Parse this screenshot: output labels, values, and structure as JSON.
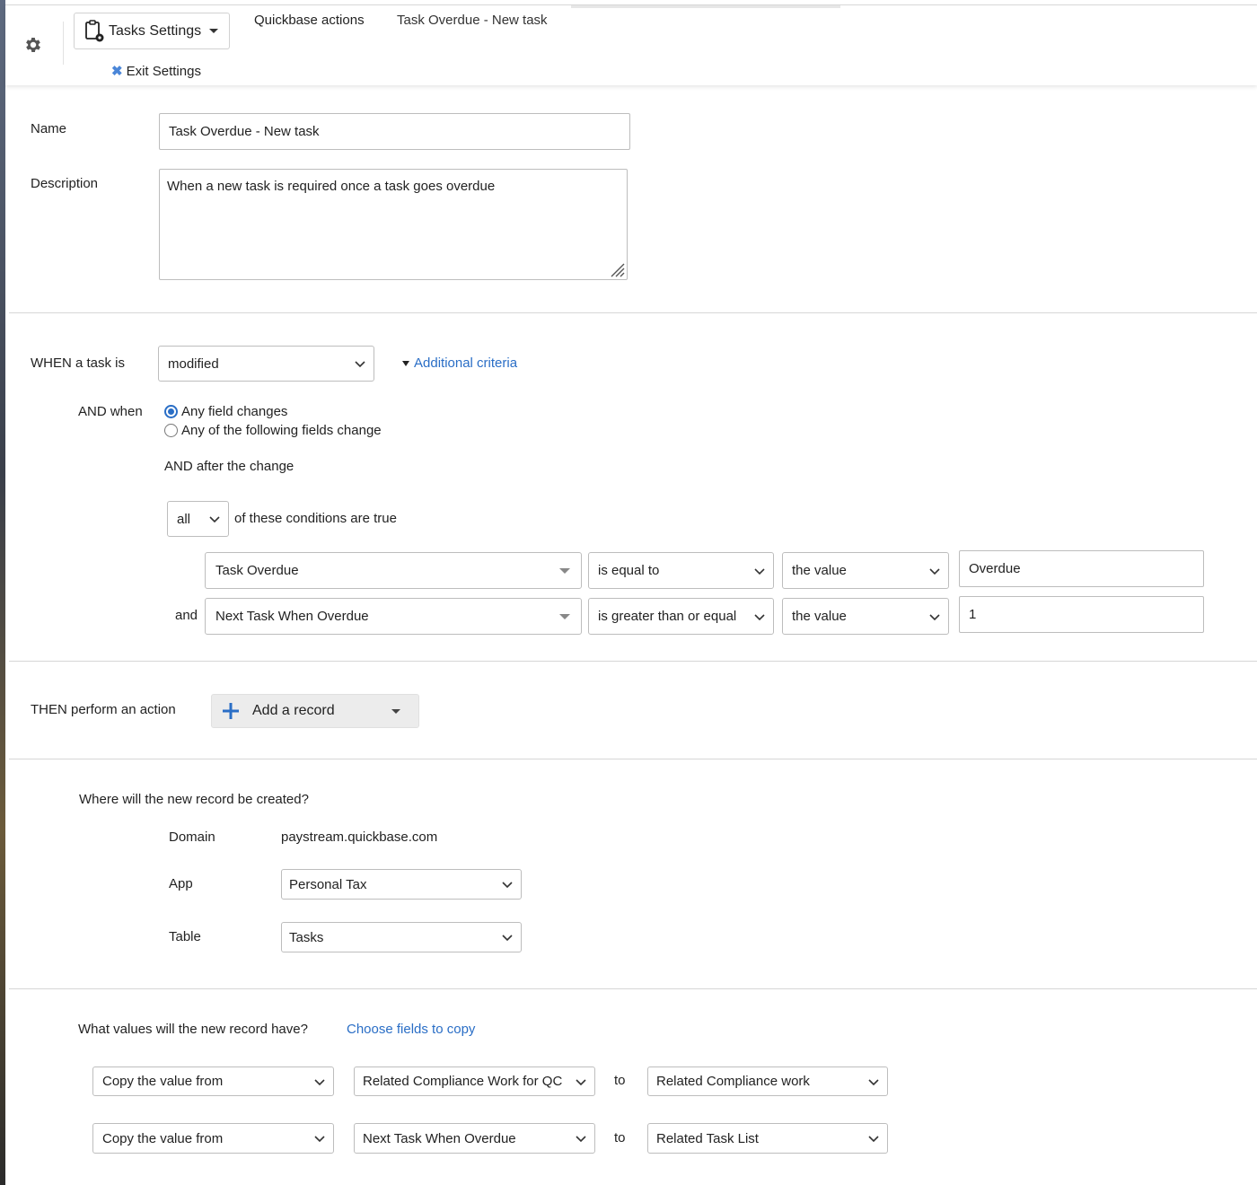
{
  "header": {
    "settings_menu_label": "Tasks Settings",
    "exit_label": "Exit Settings",
    "breadcrumb_actions": "Quickbase actions",
    "breadcrumb_current": "Task Overdue - New task"
  },
  "form": {
    "name_label": "Name",
    "name_value": "Task Overdue - New task",
    "description_label": "Description",
    "description_value": "When a new task is required once a task goes overdue"
  },
  "trigger": {
    "when_label": "WHEN a task is",
    "when_value": "modified",
    "additional_criteria": "Additional criteria",
    "and_when_label": "AND when",
    "radio_any_field": "Any field changes",
    "radio_following_fields": "Any of the following fields change",
    "after_change_label": "AND after the change",
    "quantifier_value": "all",
    "conditions_suffix": "of these conditions are true",
    "conditions": [
      {
        "connector": "",
        "field": "Task Overdue",
        "operator": "is equal to",
        "compare": "the value",
        "value": "Overdue"
      },
      {
        "connector": "and",
        "field": "Next Task When Overdue",
        "operator": "is greater than or equal",
        "compare": "the value",
        "value": "1"
      }
    ]
  },
  "action": {
    "then_label": "THEN perform an action",
    "action_button": "Add a record"
  },
  "destination": {
    "question": "Where will the new record be created?",
    "domain_label": "Domain",
    "domain_value": "paystream.quickbase.com",
    "app_label": "App",
    "app_value": "Personal Tax",
    "table_label": "Table",
    "table_value": "Tasks"
  },
  "values": {
    "question": "What values will the new record have?",
    "choose_link": "Choose fields to copy",
    "rows": [
      {
        "mode": "Copy the value from",
        "source": "Related Compliance Work for QC",
        "to": "to",
        "target": "Related Compliance work"
      },
      {
        "mode": "Copy the value from",
        "source": "Next Task When Overdue",
        "to": "to",
        "target": "Related Task List"
      }
    ]
  },
  "colors": {
    "accent": "#2a6ec6",
    "border": "#bdbdbd",
    "divider": "#d6d6d6"
  }
}
